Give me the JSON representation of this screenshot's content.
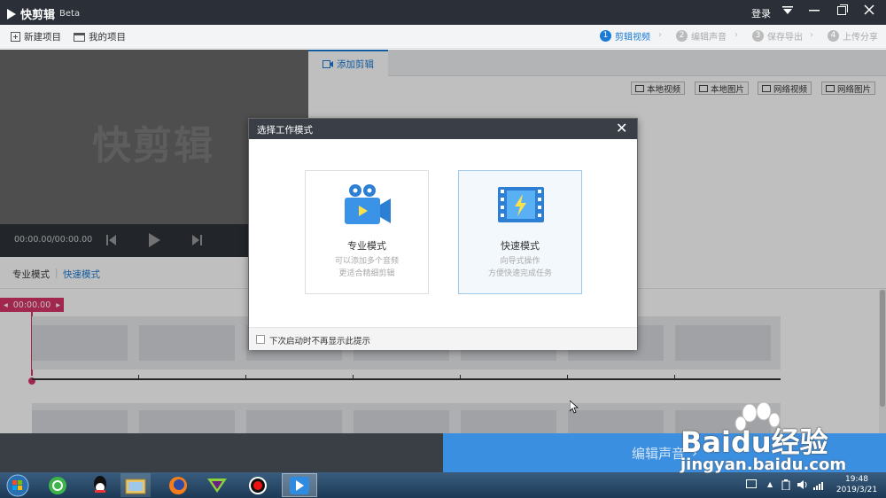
{
  "app": {
    "name": "快剪辑",
    "beta": "Beta",
    "login": "登录"
  },
  "toolbar": {
    "new_project": "新建项目",
    "my_projects": "我的项目"
  },
  "steps": [
    {
      "num": "1",
      "label": "剪辑视频"
    },
    {
      "num": "2",
      "label": "编辑声音"
    },
    {
      "num": "3",
      "label": "保存导出"
    },
    {
      "num": "4",
      "label": "上传分享"
    }
  ],
  "preview": {
    "watermark": "快剪辑",
    "time": "00:00.00/00:00.00"
  },
  "tabs": {
    "add_clip": "添加剪辑"
  },
  "sources": [
    "本地视频",
    "本地图片",
    "网络视频",
    "网络图片"
  ],
  "modes": {
    "pro": "专业模式",
    "separator": "|",
    "fast": "快速模式"
  },
  "timeline": {
    "playhead": "00:00.00"
  },
  "bottom": {
    "edit_audio": "编辑声音",
    "arrow": "›"
  },
  "modal": {
    "title": "选择工作模式",
    "close": "✕",
    "pro_title": "专业模式",
    "pro_desc1": "可以添加多个音频",
    "pro_desc2": "更适合精细剪辑",
    "fast_title": "快速模式",
    "fast_desc1": "向导式操作",
    "fast_desc2": "方便快速完成任务",
    "no_show": "下次启动时不再显示此提示"
  },
  "taskbar": {
    "time": "19:48",
    "date": "2019/3/21"
  },
  "watermark": {
    "brand": "Baidu经验",
    "url": "jingyan.baidu.com"
  },
  "colors": {
    "accent": "#1a7ad4",
    "playhead": "#d9356a",
    "cta": "#3b8fe0",
    "titlebar": "#2b3038"
  }
}
